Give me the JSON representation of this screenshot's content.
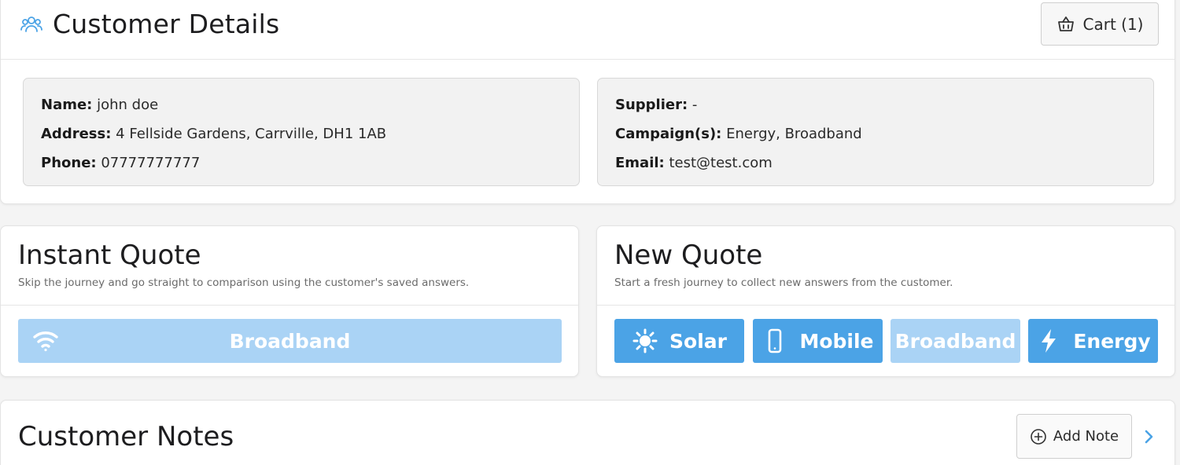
{
  "header": {
    "title": "Customer Details",
    "cart_label": "Cart (1)"
  },
  "customer": {
    "name_label": "Name:",
    "name": "john doe",
    "address_label": "Address:",
    "address": "4 Fellside Gardens, Carrville, DH1 1AB",
    "phone_label": "Phone:",
    "phone": "07777777777",
    "supplier_label": "Supplier:",
    "supplier": "-",
    "campaigns_label": "Campaign(s):",
    "campaigns": "Energy, Broadband",
    "email_label": "Email:",
    "email": "test@test.com"
  },
  "instant_quote": {
    "title": "Instant Quote",
    "subtitle": "Skip the journey and go straight to comparison using the customer's saved answers.",
    "buttons": [
      {
        "label": "Broadband",
        "icon": "wifi-icon",
        "state": "disabled"
      }
    ]
  },
  "new_quote": {
    "title": "New Quote",
    "subtitle": "Start a fresh journey to collect new answers from the customer.",
    "buttons": [
      {
        "label": "Solar",
        "icon": "sun-icon",
        "state": "active"
      },
      {
        "label": "Mobile",
        "icon": "mobile-phone-icon",
        "state": "active"
      },
      {
        "label": "Broadband",
        "icon": "",
        "state": "disabled"
      },
      {
        "label": "Energy",
        "icon": "lightning-bolt-icon",
        "state": "active"
      }
    ]
  },
  "notes": {
    "title": "Customer Notes",
    "add_note_label": "Add Note"
  },
  "colors": {
    "accent": "#4ba3e6",
    "accent_disabled": "#aad3f5",
    "people_icon": "#4ba3e6"
  }
}
